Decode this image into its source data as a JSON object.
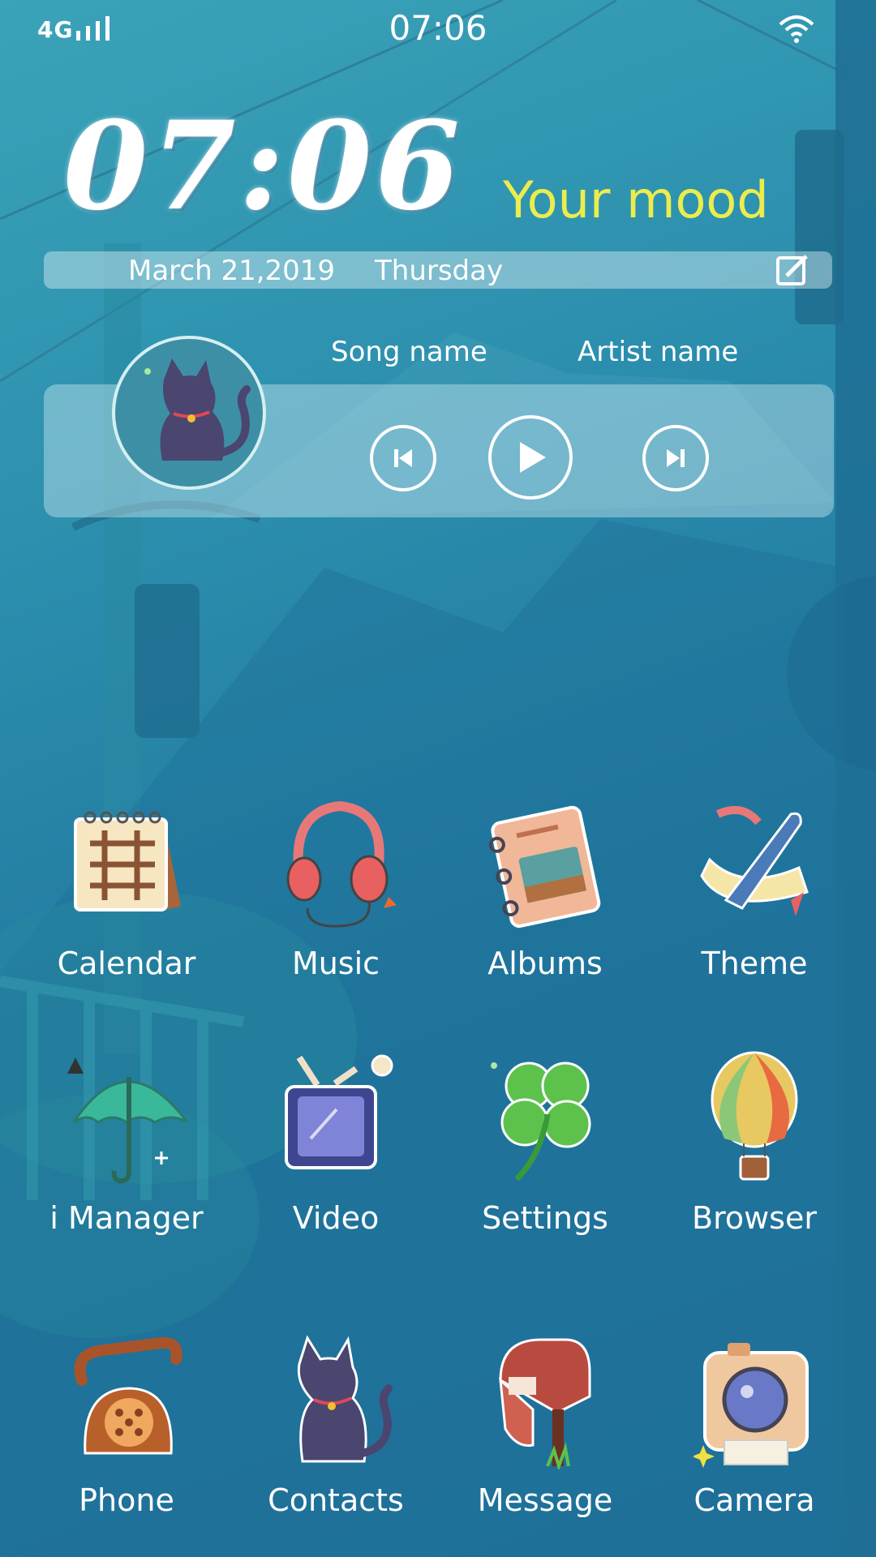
{
  "status_bar": {
    "network": "4G",
    "time": "07:06"
  },
  "clock_widget": {
    "time": "07:06",
    "mood": "Your mood",
    "date": "March 21,2019",
    "day": "Thursday"
  },
  "music_widget": {
    "song_name": "Song name",
    "artist_name": "Artist name"
  },
  "apps": [
    {
      "label": "Calendar",
      "icon": "calendar-icon"
    },
    {
      "label": "Music",
      "icon": "headphones-icon"
    },
    {
      "label": "Albums",
      "icon": "album-book-icon"
    },
    {
      "label": "Theme",
      "icon": "paintbrush-icon"
    },
    {
      "label": "i Manager",
      "icon": "umbrella-icon"
    },
    {
      "label": "Video",
      "icon": "tv-icon"
    },
    {
      "label": "Settings",
      "icon": "clover-icon"
    },
    {
      "label": "Browser",
      "icon": "hot-air-balloon-icon"
    },
    {
      "label": "Phone",
      "icon": "rotary-phone-icon"
    },
    {
      "label": "Contacts",
      "icon": "cat-icon"
    },
    {
      "label": "Message",
      "icon": "mailbox-icon"
    },
    {
      "label": "Camera",
      "icon": "camera-icon"
    }
  ],
  "colors": {
    "mood_text": "#ecec4c",
    "background": "#20779e",
    "accent_light": "#a8dbe6"
  }
}
